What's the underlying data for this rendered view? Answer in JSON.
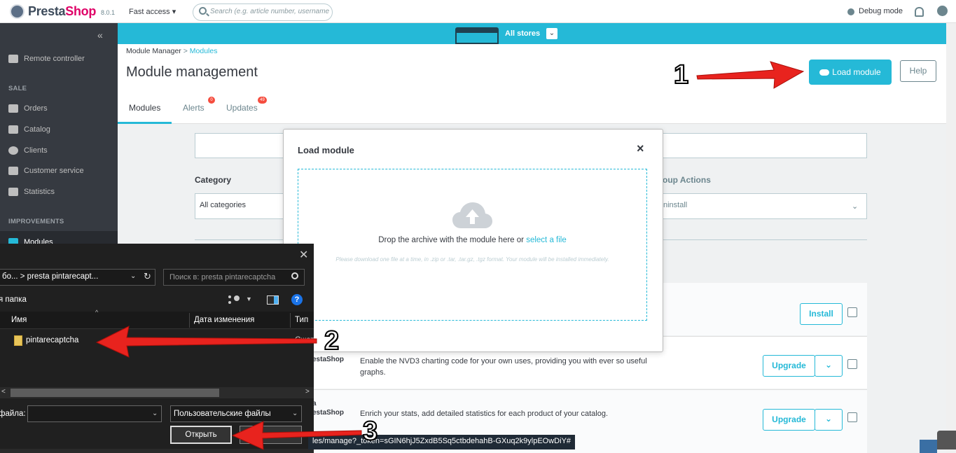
{
  "topbar": {
    "logo_text_a": "Presta",
    "logo_text_b": "Shop",
    "version": "8.0.1",
    "fast_access": "Fast access ▾",
    "search_placeholder": "Search (e.g. article number, username",
    "debug_mode": "Debug mode"
  },
  "sidebar": {
    "collapse": "«",
    "remote_controller": "Remote controller",
    "section_sale": "SALE",
    "orders": "Orders",
    "catalog": "Catalog",
    "clients": "Clients",
    "customer_service": "Customer service",
    "statistics": "Statistics",
    "section_improvements": "IMPROVEMENTS",
    "modules": "Modules"
  },
  "store_banner": {
    "label": "All stores",
    "chevron": "⌄"
  },
  "header": {
    "breadcrumb_root": "Module Manager",
    "breadcrumb_sep": ">",
    "breadcrumb_current": "Modules",
    "title": "Module management",
    "load_module": "Load module",
    "help": "Help"
  },
  "tabs": [
    {
      "label": "Modules"
    },
    {
      "label": "Alerts",
      "badge": "0"
    },
    {
      "label": "Updates",
      "badge": "49"
    }
  ],
  "content": {
    "category_label": "Category",
    "category_value": "All categories",
    "group_label": "oup Actions",
    "group_value": "ninstall",
    "card1_partial": "d",
    "card1_btn": "Install",
    "card2_author": "estaShop",
    "card2_desc": "Enable the NVD3 charting code for your own uses, providing you with ever so useful graphs.",
    "card2_btn": "Upgrade",
    "card3_author_a": "a",
    "card3_author_b": "estaShop",
    "card3_desc": "Enrich your stats, add detailed statistics for each product of your catalog.",
    "card3_btn": "Upgrade",
    "dropdown_chev": "⌄"
  },
  "modal": {
    "title": "Load module",
    "close": "×",
    "drop_text": "Drop the archive with the module here or",
    "select_file": "select a file",
    "hint": "Please download one file at a time, in .zip or .tar, .tar.gz, .tgz format. Your module will be installed immediately."
  },
  "file_dialog": {
    "close": "✕",
    "path": "бо...  >  presta pintarecapt...",
    "search_placeholder": "Поиск в: presta pintarecaptcha",
    "new_folder": "я папка",
    "col_name": "Имя",
    "col_date": "Дата изменения",
    "col_type": "Тип",
    "file_name": "pintarecaptcha",
    "file_type": "Сжат",
    "filename_label": "файла:",
    "filetype": "Пользовательские файлы",
    "open": "Открыть"
  },
  "status_url": "les/manage?_token=sGIN6hjJ5ZxdB5Sq5ctbdehahB-GXuq2k9ylpEOwDiY#",
  "annotations": [
    "1",
    "2",
    "3"
  ],
  "colors": {
    "accent": "#25b9d7",
    "sidebar": "#363a41",
    "arrow": "#e8231e"
  }
}
